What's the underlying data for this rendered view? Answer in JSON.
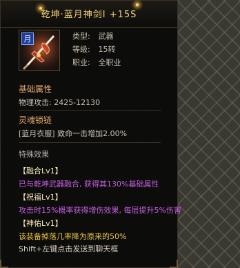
{
  "item": {
    "title": "乾坤·蓝月神剑Ⅰ  +15S",
    "icon_badge": "月",
    "icon": "sword-icon",
    "type_label": "类型:",
    "type_value": "武器",
    "level_label": "等级:",
    "level_value": "15转",
    "job_label": "职业:",
    "job_value": "全职业"
  },
  "base_attributes": {
    "header": "基础属性",
    "attack_label": "物理攻击:",
    "attack_value": "2425-12130"
  },
  "soul_lock": {
    "header": "灵魂锁链",
    "line": "[蓝月衣服] 致命一击增加2.00%"
  },
  "special_effects": {
    "header": "特殊效果",
    "effects": [
      {
        "name": "【融合Lv1】",
        "desc": "已与乾坤武器融合, 获得其130%基础属性"
      },
      {
        "name": "【祝福Lv1】",
        "desc": "攻击时15%概率获得增伤效果, 每层提升5%伤害"
      },
      {
        "name": "【神佑Lv1】",
        "desc": "该装备掉落几率降为原来的50%"
      }
    ]
  },
  "footer": "Shift+左键点击发送到聊天框",
  "colors": {
    "title": "#f3d377",
    "section_header": "#e6a86a",
    "effect_desc_purple": "#c65ee0",
    "effect_desc_yellow": "#e9c441"
  }
}
